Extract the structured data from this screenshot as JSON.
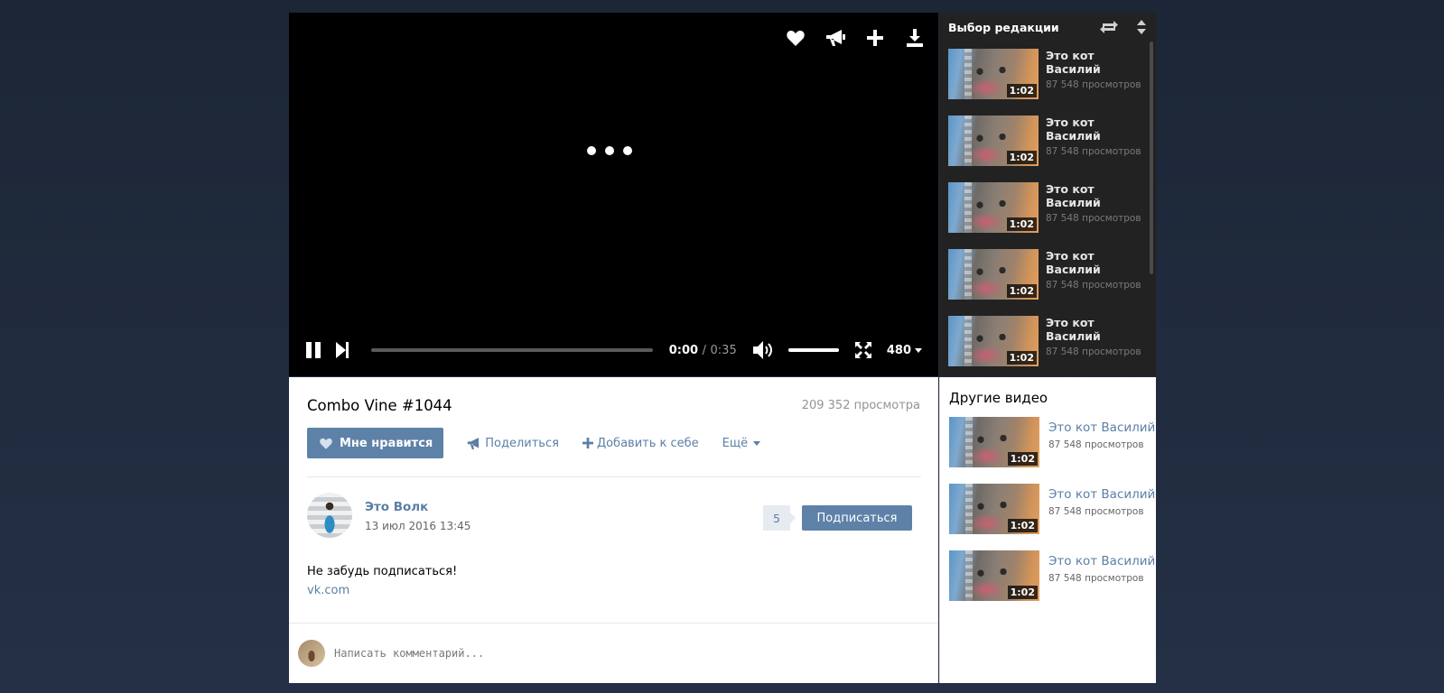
{
  "player": {
    "icons": [
      "heart-icon",
      "megaphone-icon",
      "plus-icon",
      "download-icon"
    ],
    "current_time": "0:00",
    "separator": "/",
    "duration": "0:35",
    "progress": 0.0,
    "volume": 1.0,
    "quality": "480"
  },
  "editor_picks": {
    "title": "Выбор редакции",
    "items": [
      {
        "title": "Это кот Василий",
        "views": "87 548 просмотров",
        "duration": "1:02"
      },
      {
        "title": "Это кот Василий",
        "views": "87 548 просмотров",
        "duration": "1:02"
      },
      {
        "title": "Это кот Василий",
        "views": "87 548 просмотров",
        "duration": "1:02"
      },
      {
        "title": "Это кот Василий",
        "views": "87 548 просмотров",
        "duration": "1:02"
      },
      {
        "title": "Это кот Василий",
        "views": "87 548 просмотров",
        "duration": "1:02"
      }
    ]
  },
  "video": {
    "title": "Combo Vine #1044",
    "views": "209 352 просмотра",
    "like_label": "Мне нравится",
    "share_label": "Поделиться",
    "add_label": "Добавить к себе",
    "more_label": "Ещё",
    "description": "Не забудь подписаться!",
    "link": "vk.com"
  },
  "author": {
    "name": "Это Волк",
    "date": "13 июл 2016 13:45",
    "subscriber_count": "5",
    "subscribe_label": "Подписаться"
  },
  "comment": {
    "placeholder": "Написать комментарий..."
  },
  "other_videos": {
    "title": "Другие видео",
    "items": [
      {
        "title": "Это кот Василий",
        "views": "87 548 просмотров",
        "duration": "1:02"
      },
      {
        "title": "Это кот Василий",
        "views": "87 548 просмотров",
        "duration": "1:02"
      },
      {
        "title": "Это кот Василий",
        "views": "87 548 просмотров",
        "duration": "1:02"
      }
    ]
  },
  "colors": {
    "accent": "#5e81a8",
    "link": "#5b7fa6",
    "sidebar_dark": "#222222",
    "page_bg": "#1c2636"
  }
}
